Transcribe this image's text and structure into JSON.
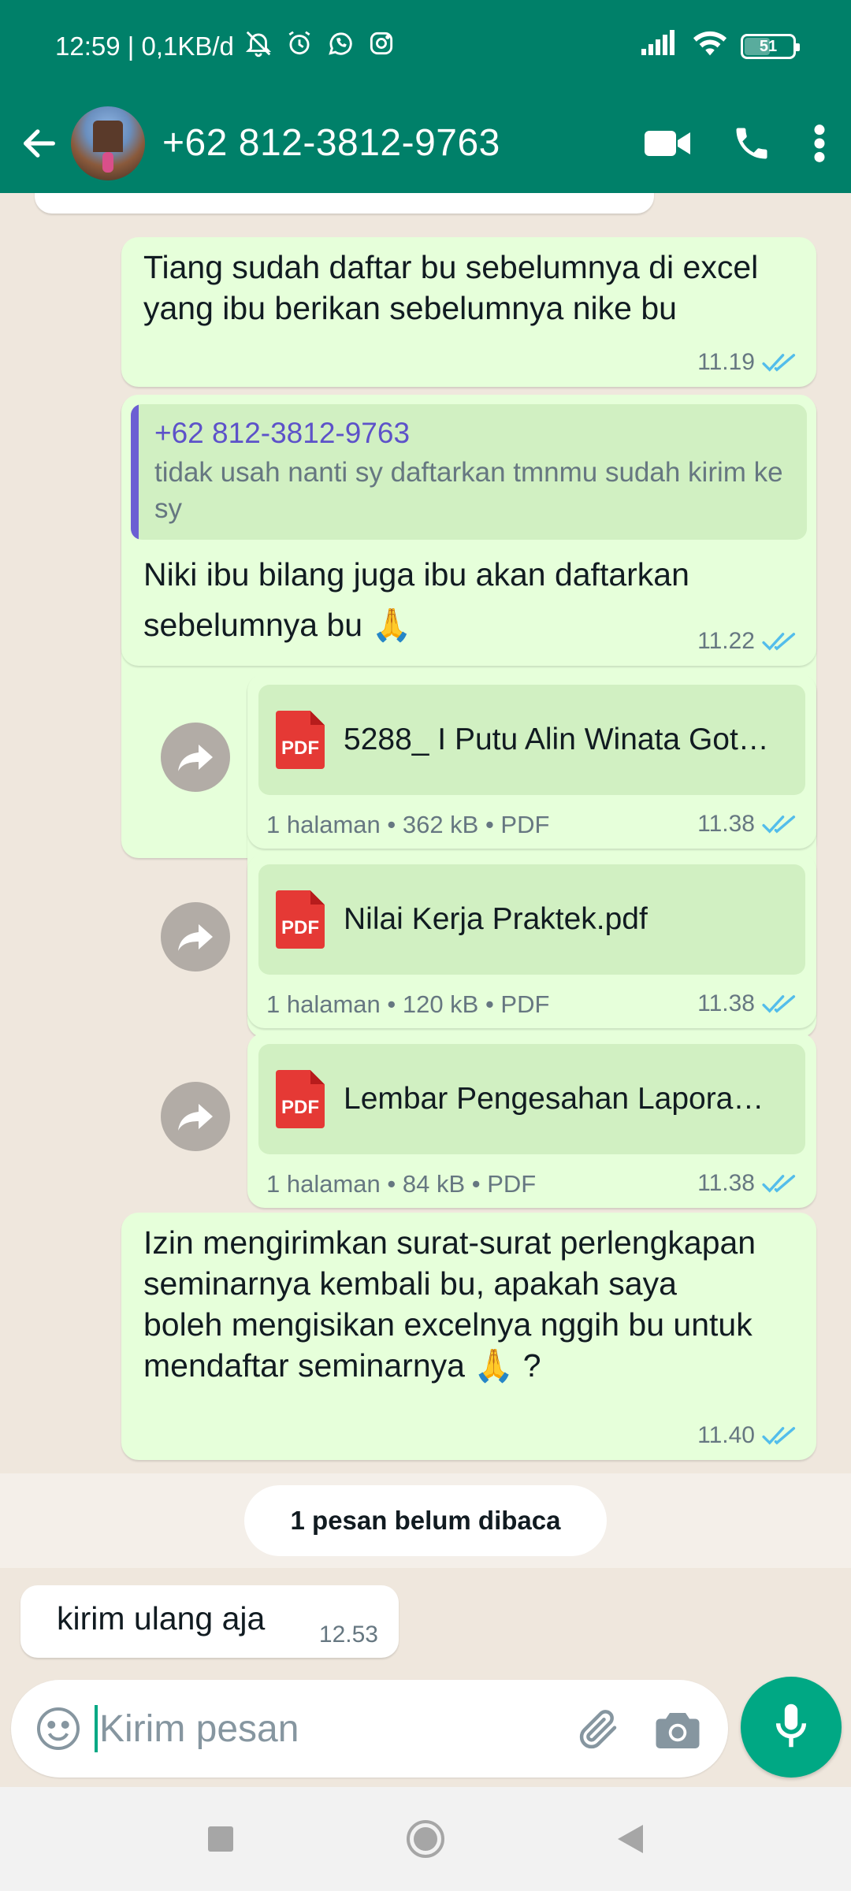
{
  "status_bar": {
    "time_speed": "12:59 | 0,1KB/d",
    "battery": "51"
  },
  "header": {
    "contact": "+62 812-3812-9763"
  },
  "messages": {
    "m1": {
      "text": "Tiang sudah daftar bu sebelumnya di excel yang ibu berikan sebelumnya nike bu",
      "time": "11.19"
    },
    "m2": {
      "quote_author": "+62 812-3812-9763",
      "quote_text": "tidak usah nanti sy daftarkan tmnmu sudah kirim ke sy",
      "text": "Niki ibu bilang juga ibu akan daftarkan sebelumnya bu 🙏",
      "time": "11.22"
    },
    "d1": {
      "name": "5288_ I Putu Alin Winata Got…",
      "info": "1 halaman • 362 kB • PDF",
      "time": "11.38",
      "badge": "PDF"
    },
    "d2": {
      "name": "Nilai Kerja Praktek.pdf",
      "info": "1 halaman • 120 kB • PDF",
      "time": "11.38",
      "badge": "PDF"
    },
    "d3": {
      "name": "Lembar Pengesahan Lapora…",
      "info": "1 halaman • 84 kB • PDF",
      "time": "11.38",
      "badge": "PDF"
    },
    "m3": {
      "text": "Izin mengirimkan surat-surat perlengkapan seminarnya kembali bu, apakah saya boleh mengisikan excelnya nggih bu untuk mendaftar seminarnya 🙏 ?",
      "time": "11.40"
    },
    "unread": "1 pesan belum dibaca",
    "m4": {
      "text": "kirim ulang aja",
      "time": "12.53"
    }
  },
  "composer": {
    "placeholder": "Kirim pesan"
  },
  "colors": {
    "header": "#008069",
    "outgoing_bubble": "#e6ffda",
    "read_ticks": "#53bdeb",
    "accent": "#00a884"
  },
  "icons": [
    "back-arrow-icon",
    "video-call-icon",
    "phone-icon",
    "more-vert-icon",
    "double-check-icon",
    "forward-icon",
    "emoji-icon",
    "attach-icon",
    "camera-icon",
    "mic-icon"
  ]
}
